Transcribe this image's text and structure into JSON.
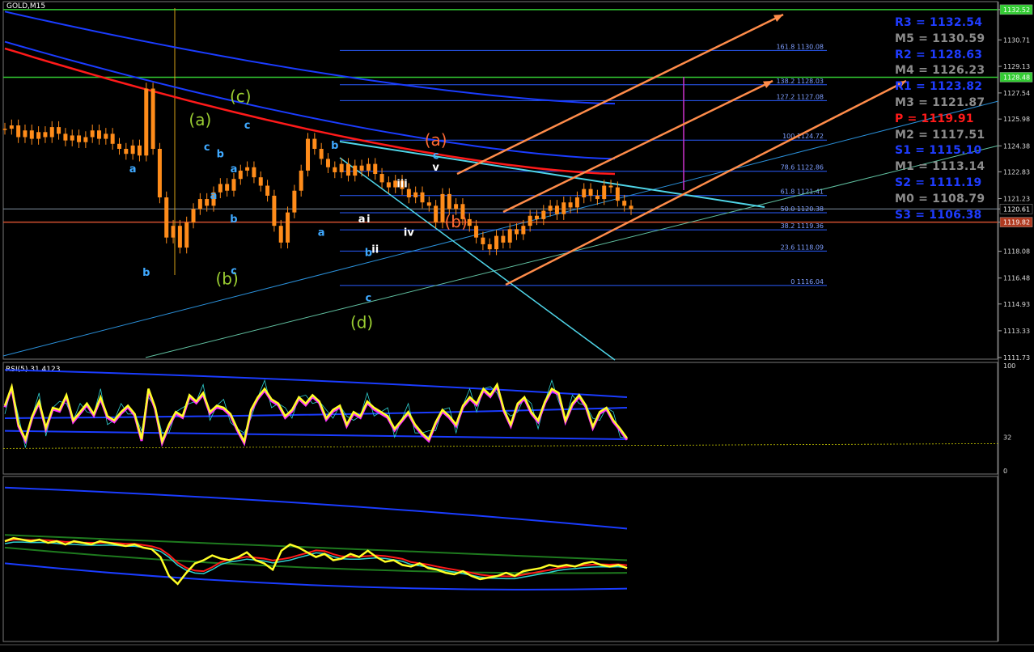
{
  "symbol_label": "GOLD,M15",
  "rsi_label": "RSI(5) 31.4123",
  "colors": {
    "background": "#000000",
    "price_candle": "#ff8c1a",
    "ma_red": "#ff1a1a",
    "ma_blue": "#1a3cff",
    "fib": "#2a5cff",
    "pivot_blue": "#1f3cff",
    "pivot_gray": "#8c8c8c",
    "pivot_red": "#ff1a1a",
    "trend_cyan": "#4fd5e8",
    "channel_orange": "#ff8c4a",
    "rsi_yellow": "#ffff26",
    "rsi_magenta": "#ff33ff",
    "green_line": "#33cc33"
  },
  "chart_data": [
    {
      "type": "candlestick",
      "symbol": "GOLD",
      "timeframe": "M15",
      "ylim": [
        1111.73,
        1132.9
      ],
      "y_ticks": [
        "1132.52",
        "1130.71",
        "1129.13",
        "1127.54",
        "1125.98",
        "1124.38",
        "1122.83",
        "1121.23",
        "1120.61",
        "1119.82",
        "1118.08",
        "1116.48",
        "1114.93",
        "1113.33",
        "1111.73"
      ],
      "price_tags": {
        "top_line": "1132.52",
        "green_line": "1128.48",
        "current_bid": "1120.61",
        "red_line": "1119.82"
      },
      "close_series": [
        1125.4,
        1125.6,
        1124.9,
        1125.3,
        1124.8,
        1125.2,
        1124.9,
        1125.5,
        1125.1,
        1124.7,
        1125.0,
        1124.6,
        1124.9,
        1125.3,
        1124.8,
        1125.1,
        1124.5,
        1124.2,
        1123.9,
        1124.4,
        1123.8,
        1127.8,
        1124.2,
        1121.3,
        1118.9,
        1119.6,
        1118.3,
        1119.8,
        1120.6,
        1121.2,
        1120.8,
        1121.6,
        1122.1,
        1121.7,
        1122.4,
        1122.9,
        1123.1,
        1122.5,
        1122.0,
        1121.4,
        1119.6,
        1118.6,
        1120.4,
        1121.7,
        1122.9,
        1124.8,
        1124.2,
        1123.6,
        1123.1,
        1122.8,
        1123.3,
        1122.6,
        1123.2,
        1122.9,
        1123.3,
        1122.7,
        1122.2,
        1121.9,
        1122.3,
        1121.8,
        1121.3,
        1121.6,
        1121.0,
        1120.8,
        1119.8,
        1121.5,
        1120.6,
        1120.9,
        1120.0,
        1119.6,
        1118.9,
        1118.5,
        1118.2,
        1119.0,
        1118.6,
        1119.4,
        1119.1,
        1119.6,
        1120.2,
        1120.0,
        1120.5,
        1120.8,
        1120.3,
        1121.0,
        1120.7,
        1121.3,
        1121.8,
        1121.4,
        1121.2,
        1122.0,
        1121.9,
        1121.1,
        1120.8,
        1120.6
      ],
      "moving_averages": [
        {
          "color": "red",
          "start": 1130.2,
          "end": 1122.7
        },
        {
          "color": "blue",
          "start": 1132.4,
          "end": 1126.9
        },
        {
          "color": "blue",
          "start": 1130.6,
          "end": 1123.6
        }
      ],
      "fibonacci_levels": [
        {
          "label": "161.8 1130.08",
          "value": 1130.08
        },
        {
          "label": "138.2 1128.03",
          "value": 1128.03
        },
        {
          "label": "127.2 1127.08",
          "value": 1127.08
        },
        {
          "label": "100 1124.72",
          "value": 1124.72
        },
        {
          "label": "78.6 1122.86",
          "value": 1122.86
        },
        {
          "label": "61.8 1121.41",
          "value": 1121.41
        },
        {
          "label": "50.0 1120.38",
          "value": 1120.38
        },
        {
          "label": "38.2 1119.36",
          "value": 1119.36
        },
        {
          "label": "23.6 1118.09",
          "value": 1118.09
        },
        {
          "label": "0 1116.04",
          "value": 1116.04
        }
      ],
      "pivot_levels": [
        {
          "label": "R3 = 1132.54",
          "value": 1132.54,
          "color": "blue"
        },
        {
          "label": "M5 = 1130.59",
          "value": 1130.59,
          "color": "gray"
        },
        {
          "label": "R2 = 1128.63",
          "value": 1128.63,
          "color": "blue"
        },
        {
          "label": "M4 = 1126.23",
          "value": 1126.23,
          "color": "gray"
        },
        {
          "label": "R1 = 1123.82",
          "value": 1123.82,
          "color": "blue"
        },
        {
          "label": "M3 = 1121.87",
          "value": 1121.87,
          "color": "gray"
        },
        {
          "label": "P = 1119.91",
          "value": 1119.91,
          "color": "red"
        },
        {
          "label": "M2 = 1117.51",
          "value": 1117.51,
          "color": "gray"
        },
        {
          "label": "S1 = 1115.10",
          "value": 1115.1,
          "color": "blue"
        },
        {
          "label": "M1 = 1113.14",
          "value": 1113.14,
          "color": "gray"
        },
        {
          "label": "S2 = 1111.19",
          "value": 1111.19,
          "color": "blue"
        },
        {
          "label": "M0 = 1108.79",
          "value": 1108.79,
          "color": "gray"
        },
        {
          "label": "S3 = 1106.38",
          "value": 1106.38,
          "color": "blue"
        }
      ],
      "wave_labels": [
        {
          "text": "(a)",
          "bar": 29,
          "price": 1125.6,
          "color": "green"
        },
        {
          "text": "(b)",
          "bar": 33,
          "price": 1116.1,
          "color": "green"
        },
        {
          "text": "(c)",
          "bar": 35,
          "price": 1127.0,
          "color": "green"
        },
        {
          "text": "(d)",
          "bar": 53,
          "price": 1113.5,
          "color": "green"
        },
        {
          "text": "(a)",
          "bar": 64,
          "price": 1124.4,
          "color": "orange"
        },
        {
          "text": "(b)",
          "bar": 67,
          "price": 1119.5,
          "color": "orange"
        },
        {
          "text": "a",
          "bar": 19,
          "price": 1122.8,
          "color": "cyan"
        },
        {
          "text": "b",
          "bar": 21,
          "price": 1116.6,
          "color": "cyan"
        },
        {
          "text": "a",
          "bar": 31,
          "price": 1121.2,
          "color": "cyan"
        },
        {
          "text": "b",
          "bar": 32,
          "price": 1123.7,
          "color": "cyan"
        },
        {
          "text": "c",
          "bar": 30,
          "price": 1124.1,
          "color": "cyan"
        },
        {
          "text": "b",
          "bar": 34,
          "price": 1119.8,
          "color": "cyan"
        },
        {
          "text": "a",
          "bar": 34,
          "price": 1122.8,
          "color": "cyan"
        },
        {
          "text": "c",
          "bar": 34,
          "price": 1116.7,
          "color": "cyan"
        },
        {
          "text": "c",
          "bar": 36,
          "price": 1125.4,
          "color": "cyan"
        },
        {
          "text": "b",
          "bar": 49,
          "price": 1124.2,
          "color": "cyan"
        },
        {
          "text": "a",
          "bar": 47,
          "price": 1119.0,
          "color": "cyan"
        },
        {
          "text": "b",
          "bar": 54,
          "price": 1117.8,
          "color": "cyan"
        },
        {
          "text": "c",
          "bar": 54,
          "price": 1115.1,
          "color": "cyan"
        },
        {
          "text": "c",
          "bar": 64,
          "price": 1123.6,
          "color": "cyan"
        },
        {
          "text": "a",
          "bar": 53,
          "price": 1119.8,
          "color": "white"
        },
        {
          "text": "i",
          "bar": 54,
          "price": 1119.8,
          "color": "white"
        },
        {
          "text": "ii",
          "bar": 55,
          "price": 1118.0,
          "color": "white"
        },
        {
          "text": "iii",
          "bar": 59,
          "price": 1121.9,
          "color": "white"
        },
        {
          "text": "iv",
          "bar": 60,
          "price": 1119.0,
          "color": "white"
        },
        {
          "text": "v",
          "bar": 64,
          "price": 1122.9,
          "color": "white"
        }
      ]
    },
    {
      "type": "line",
      "title": "RSI(5) 31.4123",
      "ylim": [
        0,
        100
      ],
      "y_ticks": [
        "100",
        "32",
        "0"
      ],
      "series": [
        {
          "name": "RSI(5)",
          "values": [
            62,
            80,
            44,
            30,
            52,
            66,
            41,
            60,
            58,
            72,
            48,
            56,
            64,
            54,
            70,
            52,
            48,
            56,
            62,
            54,
            30,
            78,
            60,
            28,
            44,
            56,
            52,
            72,
            66,
            74,
            56,
            62,
            60,
            54,
            40,
            28,
            58,
            70,
            78,
            68,
            64,
            52,
            58,
            70,
            64,
            72,
            66,
            50,
            58,
            62,
            44,
            56,
            52,
            66,
            60,
            56,
            52,
            40,
            48,
            56,
            44,
            36,
            30,
            46,
            58,
            52,
            44,
            62,
            70,
            64,
            78,
            72,
            82,
            58,
            44,
            64,
            70,
            56,
            48,
            66,
            78,
            74,
            48,
            64,
            72,
            62,
            42,
            56,
            60,
            48,
            40,
            31
          ]
        }
      ]
    },
    {
      "type": "line",
      "series": [
        {
          "name": "",
          "values": [
            62,
            64,
            63,
            62,
            63,
            61,
            62,
            60,
            62,
            61,
            60,
            62,
            61,
            60,
            59,
            60,
            58,
            57,
            52,
            40,
            35,
            42,
            48,
            50,
            53,
            51,
            50,
            52,
            55,
            50,
            48,
            44,
            56,
            60,
            58,
            55,
            52,
            54,
            50,
            51,
            54,
            52,
            56,
            52,
            49,
            50,
            47,
            46,
            48,
            45,
            44,
            42,
            41,
            43,
            40,
            38,
            39,
            40,
            42,
            40,
            43,
            44,
            45,
            47,
            46,
            47,
            46,
            48,
            49,
            47,
            46,
            47,
            45
          ]
        }
      ]
    }
  ]
}
